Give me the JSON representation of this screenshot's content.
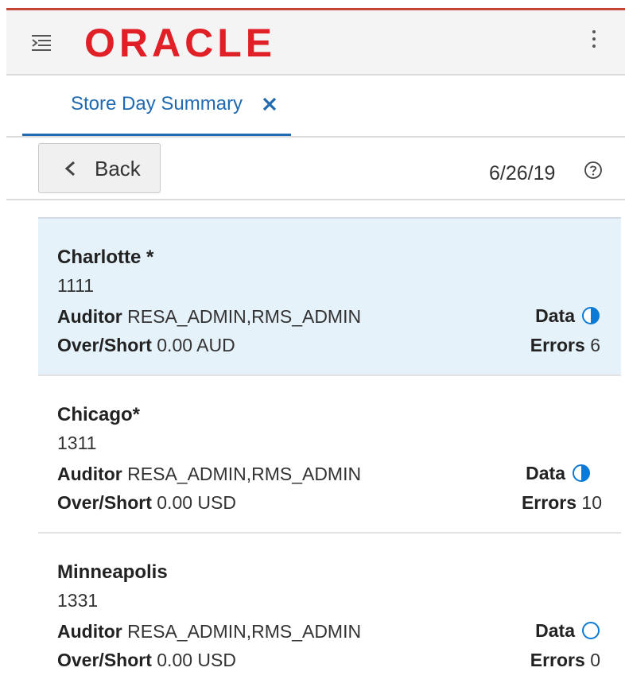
{
  "app": {
    "brand": "ORACLE",
    "accent_color": "#c74634",
    "brand_color": "#e01f26"
  },
  "header": {
    "menu_icon": "nav-menu-icon",
    "overflow_icon": "more-vertical-icon"
  },
  "tabs": [
    {
      "label": "Store Day Summary",
      "close_icon": "close-icon",
      "active": true
    }
  ],
  "toolbar": {
    "back_label": "Back",
    "date": "6/26/19",
    "help_icon": "help-icon"
  },
  "stores": [
    {
      "name": "Charlotte *",
      "id": "1111",
      "auditor_label": "Auditor",
      "auditor_value": "RESA_ADMIN,RMS_ADMIN",
      "overshort_label": "Over/Short",
      "overshort_value": "0.00 AUD",
      "data_label": "Data",
      "data_status": "half-circle-icon",
      "errors_label": "Errors",
      "errors_value": "6",
      "selected": true
    },
    {
      "name": "Chicago*",
      "id": "1311",
      "auditor_label": "Auditor",
      "auditor_value": "RESA_ADMIN,RMS_ADMIN",
      "overshort_label": "Over/Short",
      "overshort_value": "0.00 USD",
      "data_label": "Data",
      "data_status": "half-circle-icon",
      "errors_label": "Errors",
      "errors_value": "10",
      "selected": false
    },
    {
      "name": "Minneapolis",
      "id": "1331",
      "auditor_label": "Auditor",
      "auditor_value": "RESA_ADMIN,RMS_ADMIN",
      "overshort_label": "Over/Short",
      "overshort_value": "0.00 USD",
      "data_label": "Data",
      "data_status": "empty-circle-icon",
      "errors_label": "Errors",
      "errors_value": "0",
      "selected": false
    }
  ],
  "colors": {
    "link_blue": "#1f6ab1",
    "selected_bg": "#e6f2fa",
    "status_blue": "#0a7ad6"
  }
}
